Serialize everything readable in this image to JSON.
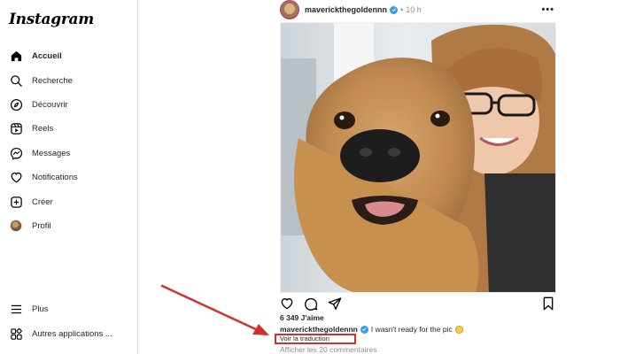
{
  "app": {
    "logo": "Instagram"
  },
  "sidebar": {
    "items": [
      {
        "label": "Accueil",
        "icon": "home-icon",
        "active": true
      },
      {
        "label": "Recherche",
        "icon": "search-icon"
      },
      {
        "label": "Découvrir",
        "icon": "compass-icon"
      },
      {
        "label": "Reels",
        "icon": "reels-icon"
      },
      {
        "label": "Messages",
        "icon": "messenger-icon"
      },
      {
        "label": "Notifications",
        "icon": "heart-icon"
      },
      {
        "label": "Créer",
        "icon": "plus-square-icon"
      },
      {
        "label": "Profil",
        "icon": "profile-avatar"
      }
    ],
    "bottom": [
      {
        "label": "Plus",
        "icon": "menu-icon"
      },
      {
        "label": "Autres applications ...",
        "icon": "apps-icon"
      }
    ]
  },
  "post": {
    "username": "maverickthegoldennn",
    "separator": "•",
    "time": "10 h",
    "more": "•••",
    "likes": "6 349 J'aime",
    "caption_user": "maverickthegoldennn",
    "caption_text": "I wasn't ready for the pic",
    "translate": "Voir la traduction",
    "comments": "Afficher les 20 commentaires"
  },
  "colors": {
    "accent_verified": "#3897f0",
    "annotation_red": "#d32f2f",
    "muted_text": "#8e8e8e"
  }
}
